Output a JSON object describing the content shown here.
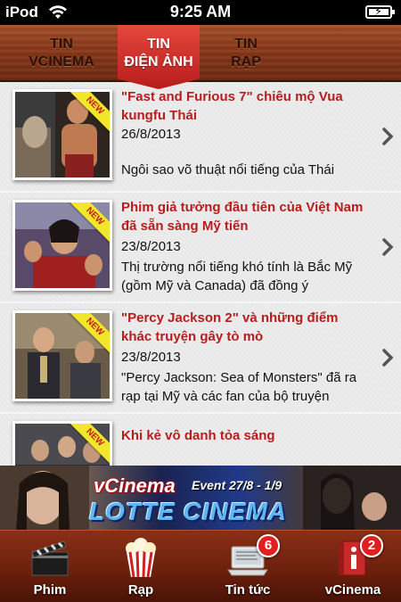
{
  "status_bar": {
    "carrier": "iPod",
    "time": "9:25 AM"
  },
  "top_tabs": [
    {
      "line1": "TIN",
      "line2": "VCINEMA"
    },
    {
      "line1": "TIN",
      "line2": "ĐIỆN ẢNH",
      "active": true
    },
    {
      "line1": "TIN",
      "line2": "RẠP"
    }
  ],
  "news": [
    {
      "badge": "NEW",
      "title": "\"Fast and Furious 7\" chiêu mộ Vua kungfu Thái",
      "date": "26/8/2013",
      "snippet": "Ngôi sao võ thuật nổi tiếng của Thái"
    },
    {
      "badge": "NEW",
      "title": "Phim giả tưởng đầu tiên của Việt Nam đã sẵn sàng Mỹ tiến",
      "date": "23/8/2013",
      "snippet": "Thị trường nổi tiếng khó tính là Bắc Mỹ (gồm Mỹ và Canada) đã đồng ý"
    },
    {
      "badge": "NEW",
      "title": "\"Percy Jackson 2\" và những điểm khác truyện gây tò mò",
      "date": "23/8/2013",
      "snippet": "\"Percy Jackson: Sea of Monsters\" đã ra rạp tại Mỹ và các fan của bộ truyện"
    },
    {
      "badge": "NEW",
      "title": "Khi kẻ vô danh tỏa sáng",
      "date": "",
      "snippet": ""
    }
  ],
  "banner": {
    "brand": "vCinema",
    "event": "Event 27/8 - 1/9",
    "title": "LOTTE CINEMA"
  },
  "bottom_tabs": [
    {
      "label": "Phim",
      "icon": "clapperboard-icon"
    },
    {
      "label": "Rạp",
      "icon": "popcorn-icon"
    },
    {
      "label": "Tin tức",
      "icon": "news-computer-icon",
      "badge": "6"
    },
    {
      "label": "vCinema",
      "icon": "info-icon",
      "badge": "2"
    }
  ],
  "colors": {
    "accent": "#b81d1d",
    "wood": "#8b3a1a",
    "ribbon": "#f2e62a"
  }
}
